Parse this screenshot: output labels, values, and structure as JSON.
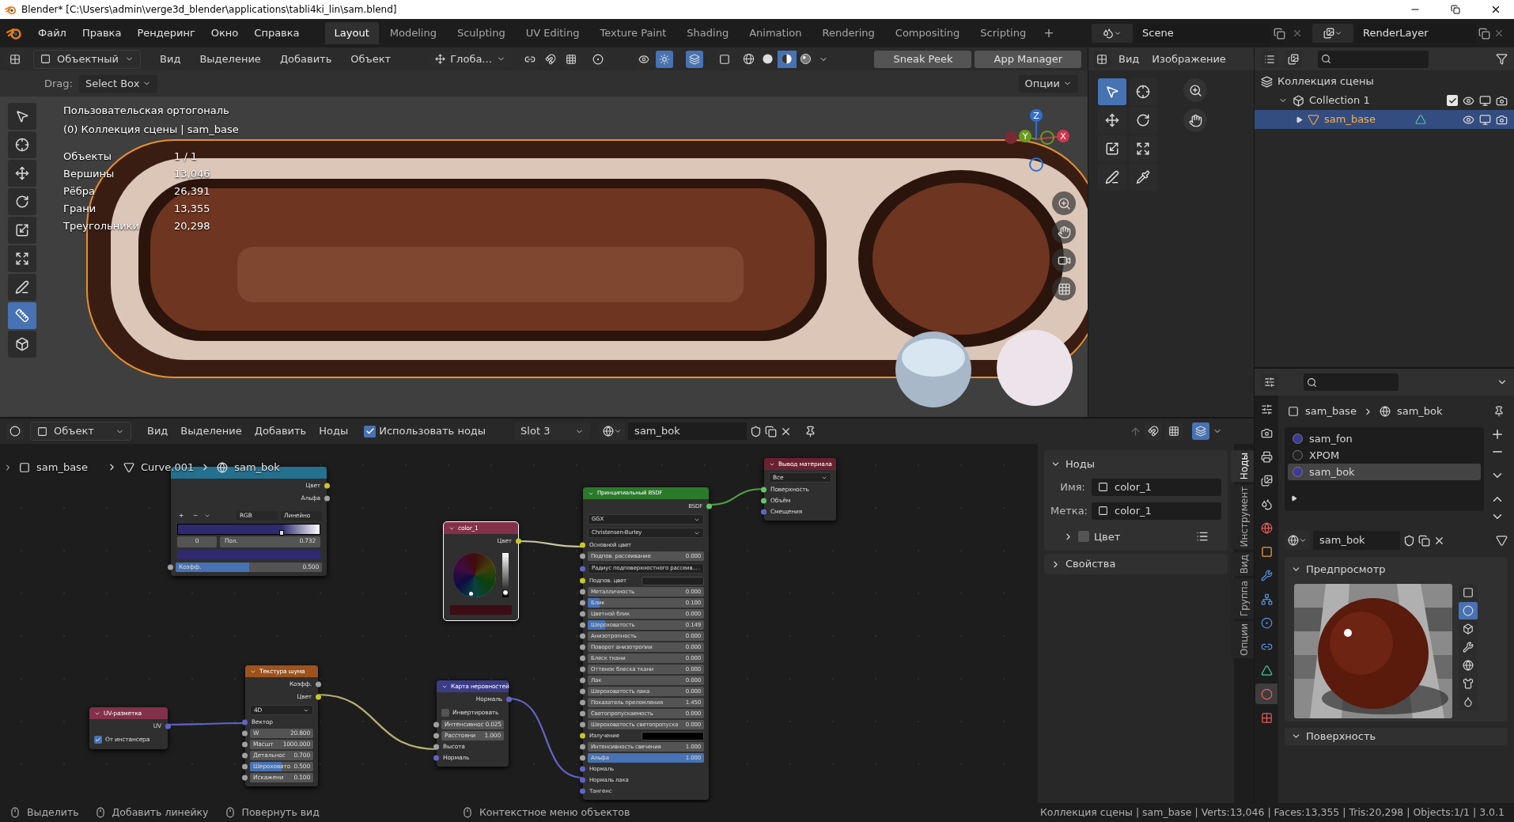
{
  "window": {
    "title": "Blender* [C:\\Users\\admin\\verge3d_blender\\applications\\tabli4ki_lin\\sam.blend]"
  },
  "menu": [
    "Файл",
    "Правка",
    "Рендеринг",
    "Окно",
    "Справка"
  ],
  "workspaces": [
    {
      "label": "Layout",
      "selected": true
    },
    {
      "label": "Modeling",
      "selected": false
    },
    {
      "label": "Sculpting",
      "selected": false
    },
    {
      "label": "UV Editing",
      "selected": false
    },
    {
      "label": "Texture Paint",
      "selected": false
    },
    {
      "label": "Shading",
      "selected": false
    },
    {
      "label": "Animation",
      "selected": false
    },
    {
      "label": "Rendering",
      "selected": false
    },
    {
      "label": "Compositing",
      "selected": false
    },
    {
      "label": "Scripting",
      "selected": false
    }
  ],
  "add_workspace": "+",
  "scene": "Scene",
  "view_layer": "RenderLayer",
  "viewport": {
    "mode": "Объектный",
    "menus": [
      "Вид",
      "Выделение",
      "Добавить",
      "Объект"
    ],
    "orientation": "Глоба...",
    "shading": [
      {
        "kind": "wireframe",
        "selected": false
      },
      {
        "kind": "solid",
        "selected": false
      },
      {
        "kind": "material",
        "selected": true
      },
      {
        "kind": "rendered",
        "selected": false
      }
    ],
    "buttons": [
      "Sneak Peek",
      "App Manager"
    ],
    "drag_label": "Drag:",
    "drag_value": "Select Box",
    "options": "Опции",
    "view_name": "Пользовательская ортогональ",
    "collection": "(0) Коллекция сцены | sam_base",
    "stats": [
      {
        "label": "Объекты",
        "value": "1 / 1"
      },
      {
        "label": "Вершины",
        "value": "13,046"
      },
      {
        "label": "Рёбра",
        "value": "26,391"
      },
      {
        "label": "Грани",
        "value": "13,355"
      },
      {
        "label": "Треугольники",
        "value": "20,298"
      }
    ],
    "tools": [
      {
        "kind": "select",
        "selected": false
      },
      {
        "kind": "cursor",
        "selected": false
      },
      {
        "kind": "move",
        "selected": false
      },
      {
        "kind": "rotate",
        "selected": false
      },
      {
        "kind": "scale",
        "selected": false
      },
      {
        "kind": "transform",
        "selected": false
      },
      {
        "kind": "annotate",
        "selected": false
      },
      {
        "kind": "measure",
        "selected": true
      },
      {
        "kind": "add_cube",
        "selected": false
      }
    ],
    "axes": [
      {
        "label": "Z",
        "color": "#2e6fd0"
      },
      {
        "label": "Y",
        "color": "#6b9a1e"
      },
      {
        "label": "X",
        "color": "#d0354b"
      }
    ]
  },
  "image_editor": {
    "menus": [
      "Вид",
      "Изображение"
    ],
    "tools": [
      {
        "kind": "select",
        "selected": true
      },
      {
        "kind": "cursor",
        "selected": false
      },
      {
        "kind": "move",
        "selected": false
      },
      {
        "kind": "rotate",
        "selected": false
      },
      {
        "kind": "scale",
        "selected": false
      },
      {
        "kind": "transform",
        "selected": false
      },
      {
        "kind": "annotate",
        "selected": false
      },
      {
        "kind": "sample",
        "selected": false
      }
    ]
  },
  "outliner": {
    "items": [
      {
        "label": "Коллекция сцены",
        "kind": "scene_collection",
        "selected": false,
        "children": [
          {
            "label": "Collection 1",
            "kind": "collection",
            "expanded": true,
            "checked": true,
            "selected": false,
            "children": [
              {
                "label": "sam_base",
                "kind": "object",
                "expanded": false,
                "selected": true
              }
            ]
          }
        ]
      }
    ]
  },
  "properties": {
    "object": "sam_base",
    "material": "sam_bok",
    "tabs": [
      {
        "kind": "tool",
        "selected": false
      },
      {
        "kind": "render",
        "selected": false
      },
      {
        "kind": "output",
        "selected": false
      },
      {
        "kind": "view_layer",
        "selected": false
      },
      {
        "kind": "scene",
        "selected": false
      },
      {
        "kind": "world",
        "selected": false
      },
      {
        "kind": "object",
        "selected": false
      },
      {
        "kind": "modifiers",
        "selected": false
      },
      {
        "kind": "particles",
        "selected": false
      },
      {
        "kind": "physics",
        "selected": false
      },
      {
        "kind": "constraints",
        "selected": false
      },
      {
        "kind": "data",
        "selected": false
      },
      {
        "kind": "material",
        "selected": true
      },
      {
        "kind": "texture",
        "selected": false
      }
    ],
    "slots": [
      {
        "name": "sam_fon",
        "color": "#3b3b9a",
        "selected": false
      },
      {
        "name": "ХРОМ",
        "color": "#222222",
        "selected": false
      },
      {
        "name": "sam_bok",
        "color": "#3b3b9a",
        "selected": true
      }
    ],
    "material_name": "sam_bok",
    "preview_title": "Предпросмотр",
    "preview_shapes": [
      {
        "kind": "plane",
        "selected": false
      },
      {
        "kind": "sphere",
        "selected": true
      },
      {
        "kind": "cube",
        "selected": false
      },
      {
        "kind": "hair",
        "selected": false
      },
      {
        "kind": "shaderball",
        "selected": false
      },
      {
        "kind": "cloth",
        "selected": false
      },
      {
        "kind": "fluid",
        "selected": false
      }
    ],
    "next_panel": "Поверхность"
  },
  "node_editor": {
    "mode": "Объект",
    "menus": [
      "Вид",
      "Выделение",
      "Добавить",
      "Ноды"
    ],
    "use_nodes": {
      "label": "Использовать ноды",
      "checked": true
    },
    "slot": "Slot 3",
    "material": "sam_bok",
    "breadcrumb": [
      "sam_base",
      "Curve.001",
      "sam_bok"
    ],
    "nodes": [
      {
        "kind": "converter",
        "selected": false,
        "rows": [
          {
            "kind": "output",
            "label": "Цвет",
            "socket": {
              "color": "#c7c729"
            }
          },
          {
            "kind": "output",
            "label": "Альфа",
            "socket": {
              "color": "#a1a1a1"
            }
          },
          {
            "kind": "ramp_controls",
            "buttons": [
              "+",
              "−"
            ],
            "dropdowns": [
              "RGB",
              "Линейно"
            ]
          },
          {
            "kind": "ramp",
            "color": "#2e2a6e",
            "level": 0.732
          },
          {
            "kind": "ramp_fields",
            "index": "0",
            "label": "Пол.",
            "value": "0.732"
          },
          {
            "kind": "color_bar",
            "color": "#2e2a6e"
          },
          {
            "kind": "slider",
            "label": "Коэфф.",
            "value": "0.500",
            "level": 0.5,
            "socket": {
              "color": "#a1a1a1"
            }
          }
        ]
      },
      {
        "kind": "input",
        "title": "color_1",
        "selected": true,
        "rows": [
          {
            "kind": "output",
            "label": "Цвет",
            "socket": {
              "color": "#c7c729"
            }
          },
          {
            "kind": "wheel",
            "level": 0.1
          },
          {
            "kind": "color_bar",
            "color": "#3d0c14"
          }
        ]
      },
      {
        "kind": "shader",
        "title": "Принципиальный BSDF",
        "selected": false,
        "rows": [
          {
            "kind": "output",
            "label": "BSDF",
            "socket": {
              "color": "#63c763"
            }
          },
          {
            "kind": "dropdown",
            "value": "GGX"
          },
          {
            "kind": "dropdown",
            "value": "Christensen-Burley"
          },
          {
            "kind": "input",
            "label": "Основной цвет",
            "socket": {
              "color": "#c7c729"
            }
          },
          {
            "kind": "field",
            "label": "Подпов. рассеивание",
            "value": "0.000",
            "socket": {
              "color": "#a1a1a1"
            }
          },
          {
            "kind": "dropdown",
            "value": "Радиус подповерхностного рассеив...",
            "socket": {
              "color": "#6363c7"
            }
          },
          {
            "kind": "swatch",
            "label": "Подпов. цвет",
            "color": "#202020",
            "socket": {
              "color": "#c7c729"
            }
          },
          {
            "kind": "field",
            "label": "Металличность",
            "value": "0.000",
            "socket": {
              "color": "#a1a1a1"
            }
          },
          {
            "kind": "slider",
            "label": "Блик",
            "value": "0.100",
            "level": 0.1,
            "socket": {
              "color": "#a1a1a1"
            }
          },
          {
            "kind": "field",
            "label": "Цветной блик",
            "value": "0.000",
            "socket": {
              "color": "#a1a1a1"
            }
          },
          {
            "kind": "slider",
            "label": "Шероховатость",
            "value": "0.149",
            "level": 0.149,
            "socket": {
              "color": "#a1a1a1"
            }
          },
          {
            "kind": "field",
            "label": "Анизотропность",
            "value": "0.000",
            "socket": {
              "color": "#a1a1a1"
            }
          },
          {
            "kind": "field",
            "label": "Поворот анизотропии",
            "value": "0.000",
            "socket": {
              "color": "#a1a1a1"
            }
          },
          {
            "kind": "field",
            "label": "Блеск ткани",
            "value": "0.000",
            "socket": {
              "color": "#a1a1a1"
            }
          },
          {
            "kind": "field",
            "label": "Оттенок блеска ткани",
            "value": "0.000",
            "socket": {
              "color": "#a1a1a1"
            }
          },
          {
            "kind": "field",
            "label": "Лак",
            "value": "0.000",
            "socket": {
              "color": "#a1a1a1"
            }
          },
          {
            "kind": "field",
            "label": "Шероховатость лака",
            "value": "0.000",
            "socket": {
              "color": "#a1a1a1"
            }
          },
          {
            "kind": "field",
            "label": "Показатель преломления",
            "value": "1.450",
            "socket": {
              "color": "#a1a1a1"
            }
          },
          {
            "kind": "field",
            "label": "Светопропускаемость",
            "value": "0.000",
            "socket": {
              "color": "#a1a1a1"
            }
          },
          {
            "kind": "field",
            "label": "Шероховатость светопропуска",
            "value": "0.000",
            "socket": {
              "color": "#a1a1a1"
            }
          },
          {
            "kind": "swatch",
            "label": "Излучение",
            "color": "#000000",
            "socket": {
              "color": "#c7c729"
            }
          },
          {
            "kind": "field",
            "label": "Интенсивность свечения",
            "value": "1.000",
            "socket": {
              "color": "#a1a1a1"
            }
          },
          {
            "kind": "slider",
            "label": "Альфа",
            "value": "1.000",
            "level": 1,
            "socket": {
              "color": "#a1a1a1"
            }
          },
          {
            "kind": "input",
            "label": "Нормаль",
            "socket": {
              "color": "#6363c7"
            }
          },
          {
            "kind": "input",
            "label": "Нормаль лака",
            "socket": {
              "color": "#6363c7"
            }
          },
          {
            "kind": "input",
            "label": "Тангенс",
            "socket": {
              "color": "#6363c7"
            }
          }
        ]
      },
      {
        "kind": "output",
        "title": "Вывод материала",
        "selected": false,
        "rows": [
          {
            "kind": "dropdown",
            "value": "Все"
          },
          {
            "kind": "input",
            "label": "Поверхность",
            "socket": {
              "color": "#63c763"
            }
          },
          {
            "kind": "input",
            "label": "Объём",
            "socket": {
              "color": "#63c763"
            }
          },
          {
            "kind": "input",
            "label": "Смещения",
            "socket": {
              "color": "#6363c7"
            }
          }
        ]
      },
      {
        "kind": "input",
        "title": "UV-разметка",
        "selected": false,
        "rows": [
          {
            "kind": "output",
            "label": "UV",
            "socket": {
              "color": "#6363c7"
            }
          },
          {
            "kind": "checkbox",
            "label": "От инстансера",
            "checked": true
          }
        ]
      },
      {
        "kind": "texture",
        "title": "Текстура шума",
        "selected": false,
        "rows": [
          {
            "kind": "output",
            "label": "Коэфф.",
            "socket": {
              "color": "#a1a1a1"
            }
          },
          {
            "kind": "output",
            "label": "Цвет",
            "socket": {
              "color": "#c7c729"
            }
          },
          {
            "kind": "dropdown",
            "value": "4D"
          },
          {
            "kind": "input",
            "label": "Вектор",
            "socket": {
              "color": "#6363c7"
            }
          },
          {
            "kind": "field",
            "label": "W",
            "value": "20.800",
            "socket": {
              "color": "#a1a1a1"
            }
          },
          {
            "kind": "field",
            "label": "Масшт",
            "value": "1000.000",
            "socket": {
              "color": "#a1a1a1"
            }
          },
          {
            "kind": "field",
            "label": "Детальнос",
            "value": "0.700",
            "socket": {
              "color": "#a1a1a1"
            }
          },
          {
            "kind": "slider",
            "label": "Шероховато",
            "value": "0.500",
            "level": 0.5,
            "socket": {
              "color": "#a1a1a1"
            }
          },
          {
            "kind": "field",
            "label": "Искажени",
            "value": "0.100",
            "socket": {
              "color": "#a1a1a1"
            }
          }
        ]
      },
      {
        "kind": "vector",
        "title": "Карта неровностей",
        "selected": false,
        "rows": [
          {
            "kind": "output",
            "label": "Нормаль",
            "socket": {
              "color": "#6363c7"
            }
          },
          {
            "kind": "checkbox",
            "label": "Инвертировать",
            "checked": false
          },
          {
            "kind": "field",
            "label": "Интенсивнос",
            "value": "0.025",
            "socket": {
              "color": "#a1a1a1"
            }
          },
          {
            "kind": "field",
            "label": "Расстояни",
            "value": "1.000",
            "socket": {
              "color": "#a1a1a1"
            }
          },
          {
            "kind": "input",
            "label": "Высота",
            "socket": {
              "color": "#a1a1a1"
            }
          },
          {
            "kind": "input",
            "label": "Нормаль",
            "socket": {
              "color": "#6363c7"
            }
          }
        ]
      }
    ],
    "sidebar": {
      "title": "Ноды",
      "name_label": "Имя:",
      "name": "color_1",
      "label_label": "Метка:",
      "label": "color_1",
      "color_section": {
        "label": "Цвет",
        "checked": false
      },
      "properties": "Свойства",
      "tabs": [
        {
          "label": "Ноды",
          "selected": true
        },
        {
          "label": "Инструмент",
          "selected": false
        },
        {
          "label": "Вид",
          "selected": false
        },
        {
          "label": "Группа",
          "selected": false
        },
        {
          "label": "Опции",
          "selected": false
        }
      ]
    }
  },
  "status_bar": {
    "hints": [
      "Выделить",
      "Добавить линейку",
      "Повернуть вид",
      "Контекстное меню объектов"
    ],
    "info": "Коллекция сцены | sam_base | Verts:13,046 | Faces:13,355 | Tris:20,298 | Objects:1/1 | 3.0.1"
  }
}
